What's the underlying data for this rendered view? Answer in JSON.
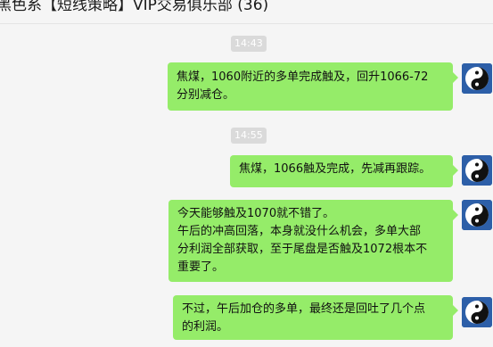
{
  "chat": {
    "title": "黑色系【短线策略】VIP交易俱乐部 (36)"
  },
  "messages": [
    {
      "time": "14:43",
      "text": "焦煤，1060附近的多单完成触及，回升1066-72\n分别减仓。",
      "avatar_icon": "yin-yang-icon"
    },
    {
      "time": "14:55",
      "text": "焦煤，1066触及完成，先减再跟踪。",
      "avatar_icon": "yin-yang-icon"
    },
    {
      "time": "",
      "text": "今天能够触及1070就不错了。\n午后的冲高回落，本身就没什么机会，多单大部\n分利润全部获取，至于尾盘是否触及1072根本不\n重要了。",
      "avatar_icon": "yin-yang-icon"
    },
    {
      "time": "",
      "text": "不过，午后加仓的多单，最终还是回吐了几个点\n的利润。",
      "avatar_icon": "yin-yang-icon"
    }
  ],
  "colors": {
    "bubble": "#95ec69",
    "background": "#f5f5f5",
    "timestamp_bg": "#dadada",
    "avatar_bg": "#2d5fa8"
  }
}
